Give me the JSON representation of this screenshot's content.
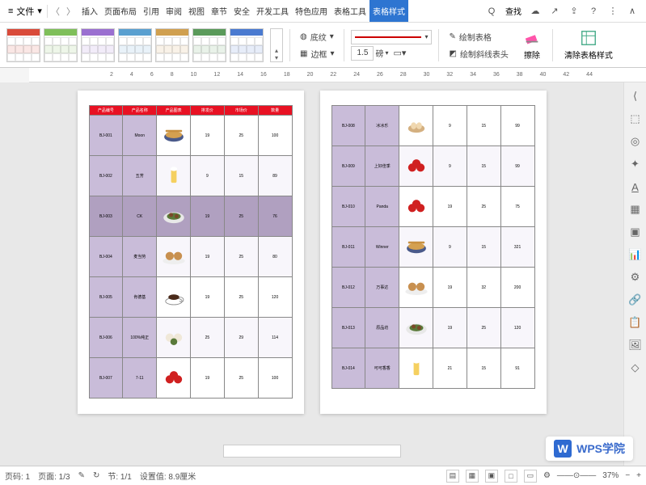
{
  "menubar": {
    "file_label": "文件",
    "tabs": [
      "插入",
      "页面布局",
      "引用",
      "审阅",
      "视图",
      "章节",
      "安全",
      "开发工具",
      "特色应用",
      "表格工具",
      "表格样式"
    ],
    "active_tab": 10,
    "search_label": "查找"
  },
  "ribbon": {
    "shading_label": "底纹",
    "border_label": "边框",
    "line_width": "1.5",
    "line_unit": "磅",
    "draw_table": "绘制表格",
    "draw_diagonal": "绘制斜线表头",
    "eraser": "擦除",
    "clear_style": "清除表格样式"
  },
  "style_gallery": {
    "colors": [
      "#d94b3a",
      "#7fbf5a",
      "#9a6fd0",
      "#5aa0d0",
      "#d0a050",
      "#5a9a5a",
      "#4a7ad0"
    ]
  },
  "ruler": {
    "marks": [
      "2",
      "4",
      "6",
      "8",
      "10",
      "12",
      "14",
      "16",
      "18",
      "20",
      "22",
      "24",
      "26",
      "28",
      "30",
      "32",
      "34",
      "36",
      "38",
      "40",
      "42",
      "44"
    ]
  },
  "table1": {
    "headers": [
      "产品编号",
      "产品名称",
      "产品图表",
      "排发价",
      "市场价",
      "数量"
    ],
    "selected_row": 2,
    "rows": [
      {
        "id": "BJ-001",
        "name": "Moon",
        "img": "soup",
        "c3": "19",
        "c4": "25",
        "c5": "100"
      },
      {
        "id": "BJ-002",
        "name": "五芳",
        "img": "beer",
        "c3": "9",
        "c4": "15",
        "c5": "89"
      },
      {
        "id": "BJ-003",
        "name": "CK",
        "img": "dish",
        "c3": "19",
        "c4": "25",
        "c5": "76"
      },
      {
        "id": "BJ-004",
        "name": "麦当劳",
        "img": "cookies",
        "c3": "19",
        "c4": "25",
        "c5": "80"
      },
      {
        "id": "BJ-005",
        "name": "肯德基",
        "img": "coffee",
        "c3": "19",
        "c4": "25",
        "c5": "120"
      },
      {
        "id": "BJ-006",
        "name": "100%纯正",
        "img": "buns",
        "c3": "25",
        "c4": "29",
        "c5": "114"
      },
      {
        "id": "BJ-007",
        "name": "7-11",
        "img": "apples",
        "c3": "19",
        "c4": "25",
        "c5": "100"
      }
    ]
  },
  "table2": {
    "rows": [
      {
        "id": "BJ-008",
        "name": "冰冰乐",
        "img": "eggs",
        "c3": "9",
        "c4": "15",
        "c5": "99"
      },
      {
        "id": "BJ-009",
        "name": "上好佳季",
        "img": "apples",
        "c3": "9",
        "c4": "15",
        "c5": "99"
      },
      {
        "id": "BJ-010",
        "name": "Panda",
        "img": "apples",
        "c3": "19",
        "c4": "25",
        "c5": "75"
      },
      {
        "id": "BJ-011",
        "name": "Winner",
        "img": "soup",
        "c3": "9",
        "c4": "15",
        "c5": "321"
      },
      {
        "id": "BJ-012",
        "name": "万事达",
        "img": "cookies",
        "c3": "19",
        "c4": "32",
        "c5": "200"
      },
      {
        "id": "BJ-013",
        "name": "原品坊",
        "img": "dish",
        "c3": "19",
        "c4": "25",
        "c5": "120"
      },
      {
        "id": "BJ-014",
        "name": "可可香香",
        "img": "beer",
        "c3": "21",
        "c4": "15",
        "c5": "91"
      }
    ]
  },
  "statusbar": {
    "page_label": "页码: 1",
    "pages_label": "页面: 1/3",
    "section_label": "节: 1/1",
    "position_label": "设置值: 8.9厘米",
    "zoom": "37%"
  },
  "watermark": {
    "text": "WPS学院"
  }
}
